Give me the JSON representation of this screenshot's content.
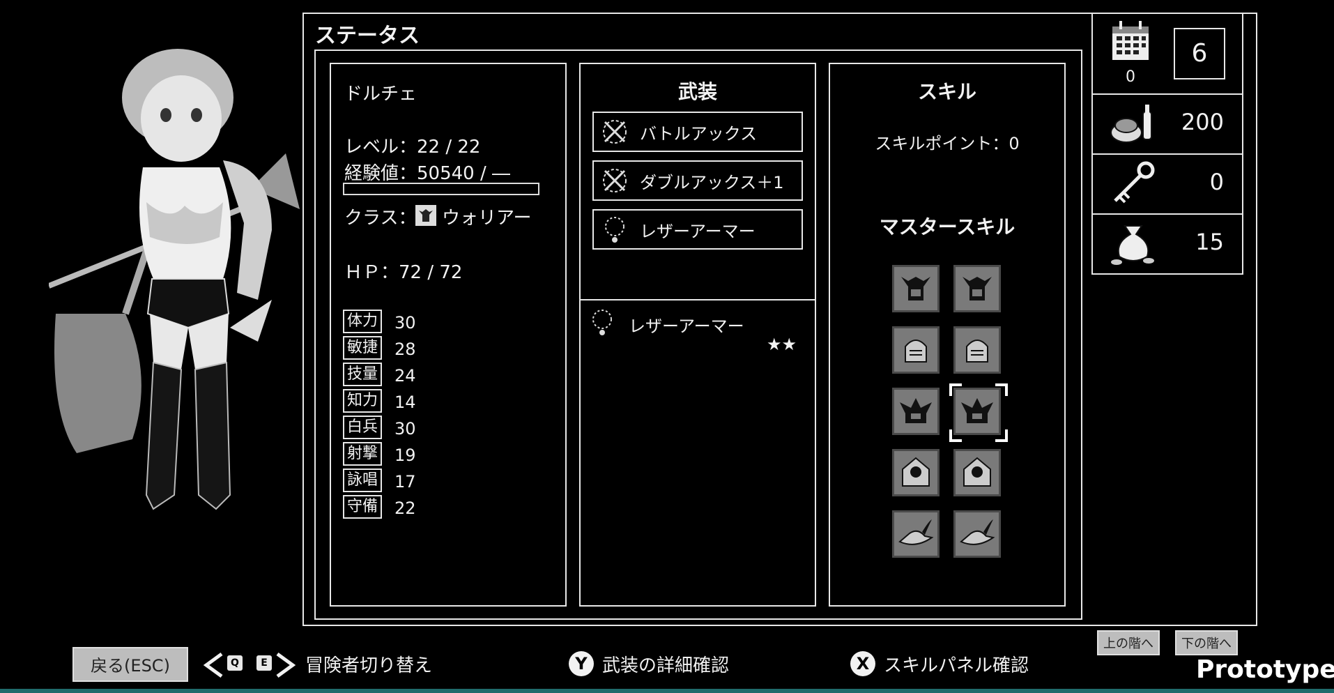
{
  "window": {
    "title": "ステータス"
  },
  "character": {
    "name": "ドルチェ",
    "level": "レベル：22 / 22",
    "exp": "経験値：50540 / ―",
    "class_prefix": "クラス：",
    "class_name": "ウォリアー",
    "hp": "ＨＰ：72 / 72"
  },
  "stats": [
    {
      "label": "体力",
      "value": "30"
    },
    {
      "label": "敏捷",
      "value": "28"
    },
    {
      "label": "技量",
      "value": "24"
    },
    {
      "label": "知力",
      "value": "14"
    },
    {
      "label": "白兵",
      "value": "30"
    },
    {
      "label": "射撃",
      "value": "19"
    },
    {
      "label": "詠唱",
      "value": "17"
    },
    {
      "label": "守備",
      "value": "22"
    }
  ],
  "equipment": {
    "heading": "武装",
    "slots": [
      {
        "name": "バトルアックス",
        "icon": "crossed-axes-icon"
      },
      {
        "name": "ダブルアックス＋1",
        "icon": "crossed-axes-icon"
      },
      {
        "name": "レザーアーマー",
        "icon": "necklace-icon"
      }
    ],
    "detail": {
      "name": "レザーアーマー",
      "rarity": "★★",
      "icon": "necklace-icon"
    }
  },
  "skills": {
    "heading": "スキル",
    "points": "スキルポイント：0",
    "master_heading": "マスタースキル",
    "tiles": [
      {
        "icon": "horned-helmet-icon"
      },
      {
        "icon": "horned-helmet-icon"
      },
      {
        "icon": "knight-helmet-icon"
      },
      {
        "icon": "knight-helmet-icon"
      },
      {
        "icon": "samurai-helmet-icon"
      },
      {
        "icon": "samurai-helmet-icon",
        "selected": true
      },
      {
        "icon": "hood-icon"
      },
      {
        "icon": "hood-icon"
      },
      {
        "icon": "feathered-hat-icon"
      },
      {
        "icon": "feathered-hat-icon"
      }
    ]
  },
  "resources": {
    "calendar_count": "0",
    "day": "6",
    "food": "200",
    "keys": "0",
    "gold": "15"
  },
  "bottom": {
    "back_label": "戻る(ESC)",
    "key_q": "Q",
    "key_e": "E",
    "switch_label": "冒険者切り替え",
    "y_button": "Y",
    "equip_detail_label": "武装の詳細確認",
    "x_button": "X",
    "skill_panel_label": "スキルパネル確認",
    "floor_up": "上の階へ",
    "floor_down": "下の階へ",
    "prototype": "Prototype"
  }
}
